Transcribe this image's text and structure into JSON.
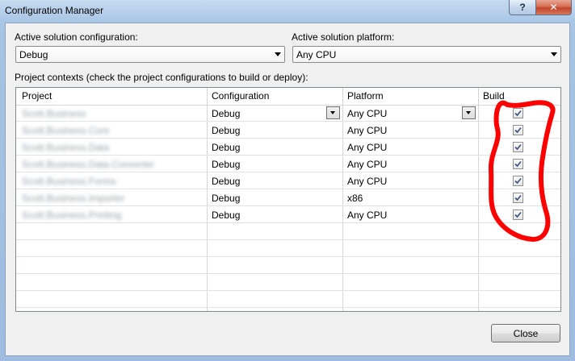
{
  "window": {
    "title": "Configuration Manager",
    "help_label": "?",
    "close_label": "✕"
  },
  "solution_configuration": {
    "label": "Active solution configuration:",
    "value": "Debug"
  },
  "solution_platform": {
    "label": "Active solution platform:",
    "value": "Any CPU"
  },
  "grid": {
    "caption": "Project contexts (check the project configurations to build or deploy):",
    "columns": [
      "Project",
      "Configuration",
      "Platform",
      "Build"
    ],
    "rows": [
      {
        "project": "Scott.Business",
        "configuration": "Debug",
        "platform": "Any CPU",
        "build": true
      },
      {
        "project": "Scott.Business.Core",
        "configuration": "Debug",
        "platform": "Any CPU",
        "build": true
      },
      {
        "project": "Scott.Business.Data",
        "configuration": "Debug",
        "platform": "Any CPU",
        "build": true
      },
      {
        "project": "Scott.Business.Data.Converter",
        "configuration": "Debug",
        "platform": "Any CPU",
        "build": true
      },
      {
        "project": "Scott.Business.Forms",
        "configuration": "Debug",
        "platform": "Any CPU",
        "build": true
      },
      {
        "project": "Scott.Business.Importer",
        "configuration": "Debug",
        "platform": "x86",
        "build": true
      },
      {
        "project": "Scott.Business.Printing",
        "configuration": "Debug",
        "platform": "Any CPU",
        "build": true
      }
    ]
  },
  "close_button": {
    "label": "Close"
  },
  "annotation": {
    "color": "#ff0000"
  }
}
